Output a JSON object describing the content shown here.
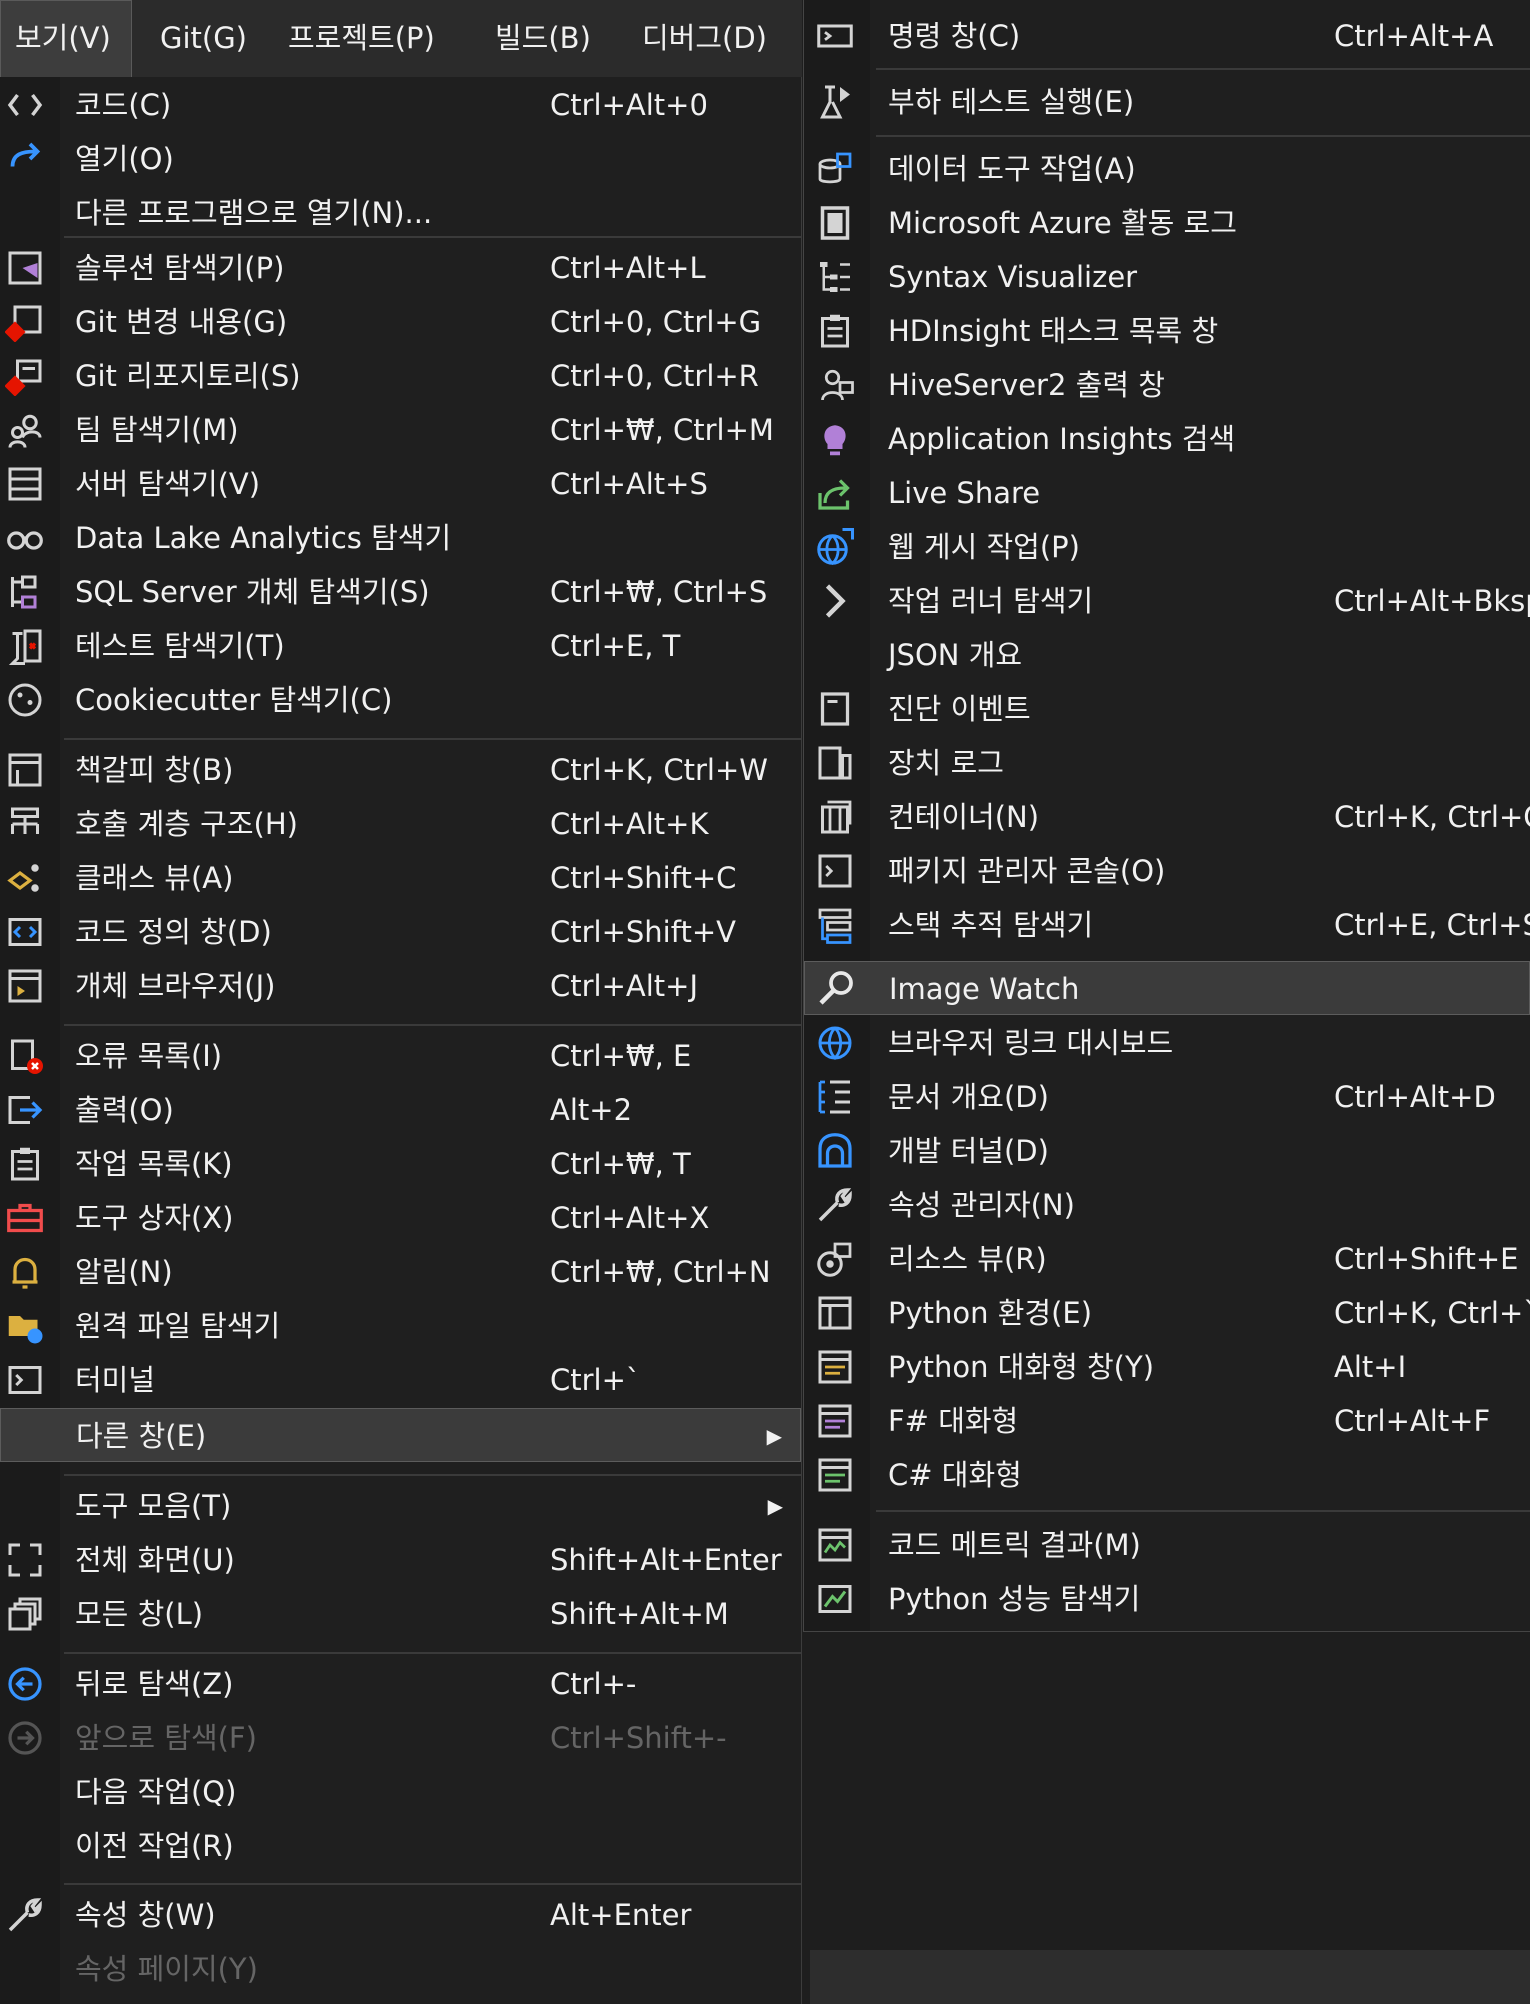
{
  "menubar": {
    "items": [
      "보기(V)",
      "Git(G)",
      "프로젝트(P)",
      "빌드(B)",
      "디버그(D)"
    ]
  },
  "main_menu": {
    "items": [
      {
        "label": "코드(C)",
        "shortcut": "Ctrl+Alt+0",
        "icon": "code-icon"
      },
      {
        "label": "열기(O)",
        "shortcut": "",
        "icon": "open-arrow-icon"
      },
      {
        "label": "다른 프로그램으로 열기(N)...",
        "shortcut": "",
        "icon": ""
      },
      {
        "label": "솔루션 탐색기(P)",
        "shortcut": "Ctrl+Alt+L",
        "icon": "solution-explorer-icon"
      },
      {
        "label": "Git 변경 내용(G)",
        "shortcut": "Ctrl+0, Ctrl+G",
        "icon": "git-changes-icon"
      },
      {
        "label": "Git 리포지토리(S)",
        "shortcut": "Ctrl+0, Ctrl+R",
        "icon": "git-repository-icon"
      },
      {
        "label": "팀 탐색기(M)",
        "shortcut": "Ctrl+₩, Ctrl+M",
        "icon": "team-explorer-icon"
      },
      {
        "label": "서버 탐색기(V)",
        "shortcut": "Ctrl+Alt+S",
        "icon": "server-explorer-icon"
      },
      {
        "label": "Data Lake Analytics 탐색기",
        "shortcut": "",
        "icon": "binoculars-icon"
      },
      {
        "label": "SQL Server 개체 탐색기(S)",
        "shortcut": "Ctrl+₩, Ctrl+S",
        "icon": "sql-server-icon"
      },
      {
        "label": "테스트 탐색기(T)",
        "shortcut": "Ctrl+E, T",
        "icon": "test-explorer-icon"
      },
      {
        "label": "Cookiecutter 탐색기(C)",
        "shortcut": "",
        "icon": "cookie-icon"
      },
      {
        "label": "책갈피 창(B)",
        "shortcut": "Ctrl+K, Ctrl+W",
        "icon": "bookmark-window-icon"
      },
      {
        "label": "호출 계층 구조(H)",
        "shortcut": "Ctrl+Alt+K",
        "icon": "call-hierarchy-icon"
      },
      {
        "label": "클래스 뷰(A)",
        "shortcut": "Ctrl+Shift+C",
        "icon": "class-view-icon"
      },
      {
        "label": "코드 정의 창(D)",
        "shortcut": "Ctrl+Shift+V",
        "icon": "code-definition-icon"
      },
      {
        "label": "개체 브라우저(J)",
        "shortcut": "Ctrl+Alt+J",
        "icon": "object-browser-icon"
      },
      {
        "label": "오류 목록(I)",
        "shortcut": "Ctrl+₩, E",
        "icon": "error-list-icon"
      },
      {
        "label": "출력(O)",
        "shortcut": "Alt+2",
        "icon": "output-icon"
      },
      {
        "label": "작업 목록(K)",
        "shortcut": "Ctrl+₩, T",
        "icon": "task-list-icon"
      },
      {
        "label": "도구 상자(X)",
        "shortcut": "Ctrl+Alt+X",
        "icon": "toolbox-icon"
      },
      {
        "label": "알림(N)",
        "shortcut": "Ctrl+₩, Ctrl+N",
        "icon": "bell-icon"
      },
      {
        "label": "원격 파일 탐색기",
        "shortcut": "",
        "icon": "remote-folder-icon"
      },
      {
        "label": "터미널",
        "shortcut": "Ctrl+`",
        "icon": "terminal-icon"
      },
      {
        "label": "다른 창(E)",
        "shortcut": "",
        "icon": ""
      },
      {
        "label": "도구 모음(T)",
        "shortcut": "",
        "icon": ""
      },
      {
        "label": "전체 화면(U)",
        "shortcut": "Shift+Alt+Enter",
        "icon": "fullscreen-icon"
      },
      {
        "label": "모든 창(L)",
        "shortcut": "Shift+Alt+M",
        "icon": "all-windows-icon"
      },
      {
        "label": "뒤로 탐색(Z)",
        "shortcut": "Ctrl+-",
        "icon": "navigate-back-icon"
      },
      {
        "label": "앞으로 탐색(F)",
        "shortcut": "Ctrl+Shift+-",
        "icon": "navigate-forward-icon"
      },
      {
        "label": "다음 작업(Q)",
        "shortcut": "",
        "icon": ""
      },
      {
        "label": "이전 작업(R)",
        "shortcut": "",
        "icon": ""
      },
      {
        "label": "속성 창(W)",
        "shortcut": "Alt+Enter",
        "icon": "wrench-icon"
      },
      {
        "label": "속성 페이지(Y)",
        "shortcut": "",
        "icon": ""
      }
    ]
  },
  "sub_menu": {
    "items": [
      {
        "label": "명령 창(C)",
        "shortcut": "Ctrl+Alt+A",
        "icon": "command-window-icon"
      },
      {
        "label": "부하 테스트 실행(E)",
        "shortcut": "",
        "icon": "load-test-icon"
      },
      {
        "label": "데이터 도구 작업(A)",
        "shortcut": "",
        "icon": "data-tools-icon"
      },
      {
        "label": "Microsoft Azure 활동 로그",
        "shortcut": "",
        "icon": "azure-log-icon"
      },
      {
        "label": "Syntax Visualizer",
        "shortcut": "",
        "icon": "syntax-tree-icon"
      },
      {
        "label": "HDInsight 태스크 목록 창",
        "shortcut": "",
        "icon": "clipboard-icon"
      },
      {
        "label": "HiveServer2 출력 창",
        "shortcut": "",
        "icon": "hive-output-icon"
      },
      {
        "label": "Application Insights 검색",
        "shortcut": "",
        "icon": "lightbulb-icon"
      },
      {
        "label": "Live Share",
        "shortcut": "",
        "icon": "live-share-icon"
      },
      {
        "label": "웹 게시 작업(P)",
        "shortcut": "",
        "icon": "web-publish-icon"
      },
      {
        "label": "작업 러너 탐색기",
        "shortcut": "Ctrl+Alt+Bkspc",
        "icon": "chevron-right-icon"
      },
      {
        "label": "JSON 개요",
        "shortcut": "",
        "icon": ""
      },
      {
        "label": "진단 이벤트",
        "shortcut": "",
        "icon": "diagnostic-events-icon"
      },
      {
        "label": "장치 로그",
        "shortcut": "",
        "icon": "device-log-icon"
      },
      {
        "label": "컨테이너(N)",
        "shortcut": "Ctrl+K, Ctrl+O",
        "icon": "container-icon"
      },
      {
        "label": "패키지 관리자 콘솔(O)",
        "shortcut": "",
        "icon": "console-icon"
      },
      {
        "label": "스택 추적 탐색기",
        "shortcut": "Ctrl+E, Ctrl+S",
        "icon": "stack-trace-icon"
      },
      {
        "label": "Image Watch",
        "shortcut": "",
        "icon": "magnifier-icon"
      },
      {
        "label": "브라우저 링크 대시보드",
        "shortcut": "",
        "icon": "browser-link-icon"
      },
      {
        "label": "문서 개요(D)",
        "shortcut": "Ctrl+Alt+D",
        "icon": "document-outline-icon"
      },
      {
        "label": "개발 터널(D)",
        "shortcut": "",
        "icon": "dev-tunnel-icon"
      },
      {
        "label": "속성 관리자(N)",
        "shortcut": "",
        "icon": "property-manager-icon"
      },
      {
        "label": "리소스 뷰(R)",
        "shortcut": "Ctrl+Shift+E",
        "icon": "resource-view-icon"
      },
      {
        "label": "Python 환경(E)",
        "shortcut": "Ctrl+K, Ctrl+`",
        "icon": "python-env-icon"
      },
      {
        "label": "Python 대화형 창(Y)",
        "shortcut": "Alt+I",
        "icon": "python-interactive-icon"
      },
      {
        "label": "F# 대화형",
        "shortcut": "Ctrl+Alt+F",
        "icon": "fsharp-interactive-icon"
      },
      {
        "label": "C# 대화형",
        "shortcut": "",
        "icon": "csharp-interactive-icon"
      },
      {
        "label": "코드 메트릭 결과(M)",
        "shortcut": "",
        "icon": "code-metrics-icon"
      },
      {
        "label": "Python 성능 탐색기",
        "shortcut": "",
        "icon": "python-perf-icon"
      }
    ]
  },
  "colors": {
    "menu_bg": "#1f1f1f",
    "highlight_bg": "#3b3b3b",
    "text": "#f1f1f1",
    "disabled_text": "#656565",
    "accent_blue": "#3794ff",
    "accent_red": "#e51400",
    "accent_purple": "#b180d7",
    "accent_yellow": "#dcb040",
    "accent_green": "#6cc36c"
  }
}
